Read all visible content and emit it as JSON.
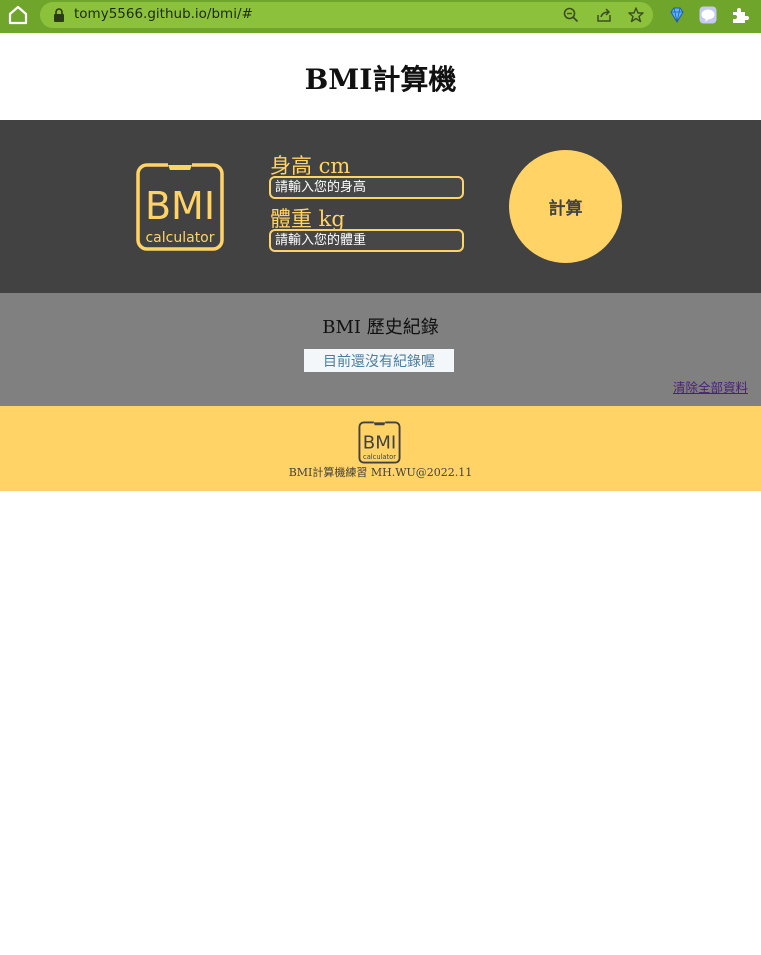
{
  "browser": {
    "url": "tomy5566.github.io/bmi/#",
    "icons": [
      "home-icon",
      "lock-icon",
      "zoom-icon",
      "share-icon",
      "bookmark-star-icon",
      "gem-extension-icon",
      "line-extension-icon",
      "puzzle-extensions-icon"
    ]
  },
  "page": {
    "title": "BMI計算機"
  },
  "calculator": {
    "logo_text_top": "BMI",
    "logo_text_bottom": "calculator",
    "height_label": "身高 cm",
    "height_placeholder": "請輸入您的身高",
    "height_value": "",
    "weight_label": "體重 kg",
    "weight_placeholder": "請輸入您的體重",
    "weight_value": "",
    "calc_button": "計算"
  },
  "history": {
    "title": "BMI 歷史紀錄",
    "empty_message": "目前還沒有紀錄喔",
    "clear_link": "清除全部資料"
  },
  "footer": {
    "logo_text_top": "BMI",
    "logo_text_bottom": "calculator",
    "text": "BMI計算機練習 MH.WU@2022.11"
  },
  "colors": {
    "browser_bar": "#6fa52a",
    "url_pill": "#8cc23b",
    "dark": "#424242",
    "accent": "#ffd366",
    "history_bg": "#808080"
  }
}
